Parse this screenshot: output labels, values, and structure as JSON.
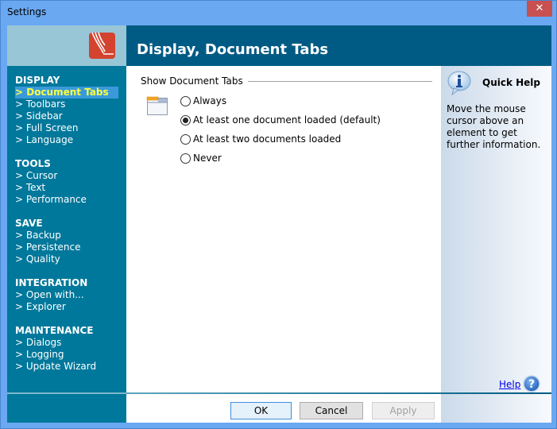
{
  "window": {
    "title": "Settings",
    "close_label": "✕"
  },
  "header": {
    "title": "Display, Document Tabs"
  },
  "sidebar": {
    "groups": [
      {
        "heading": "DISPLAY",
        "items": [
          "> Document Tabs",
          "> Toolbars",
          "> Sidebar",
          "> Full Screen",
          "> Language"
        ]
      },
      {
        "heading": "TOOLS",
        "items": [
          "> Cursor",
          "> Text",
          "> Performance"
        ]
      },
      {
        "heading": "SAVE",
        "items": [
          "> Backup",
          "> Persistence",
          "> Quality"
        ]
      },
      {
        "heading": "INTEGRATION",
        "items": [
          "> Open with...",
          "> Explorer"
        ]
      },
      {
        "heading": "MAINTENANCE",
        "items": [
          "> Dialogs",
          "> Logging",
          "> Update Wizard"
        ]
      }
    ],
    "active_item": "> Document Tabs"
  },
  "content": {
    "group_label": "Show Document Tabs",
    "options": [
      {
        "label": "Always",
        "checked": false
      },
      {
        "label": "At least one document loaded (default)",
        "checked": true
      },
      {
        "label": "At least two documents loaded",
        "checked": false
      },
      {
        "label": "Never",
        "checked": false
      }
    ]
  },
  "quick_help": {
    "title": "Quick Help",
    "text": "Move the mouse cursor above an element to get further information."
  },
  "footer": {
    "ok_label": "OK",
    "cancel_label": "Cancel",
    "apply_label": "Apply",
    "help_label": "Help"
  },
  "colors": {
    "header_bg": "#005b84",
    "sidebar_bg": "#00789b",
    "active_item_text": "#ffff40",
    "active_item_bg": "#3a9ad9",
    "logo_red": "#d3432f"
  }
}
